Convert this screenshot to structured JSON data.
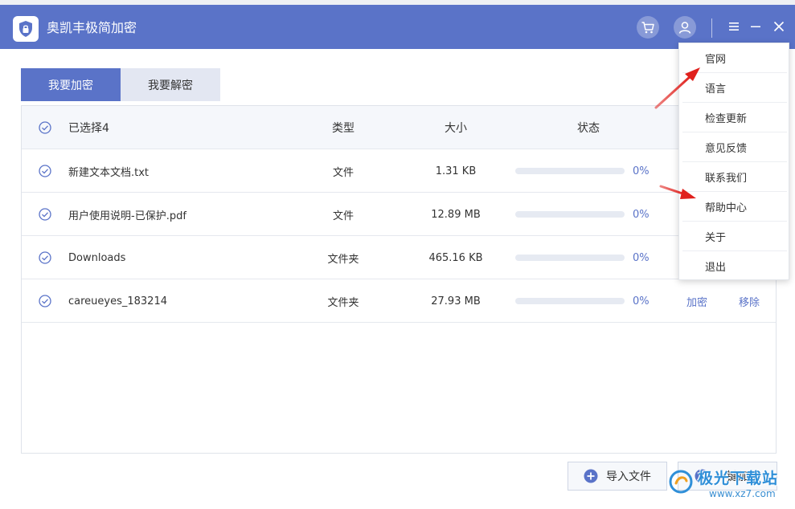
{
  "window": {
    "title": "奥凯丰极简加密"
  },
  "tabs": [
    {
      "label": "我要加密",
      "active": true
    },
    {
      "label": "我要解密",
      "active": false
    }
  ],
  "table": {
    "header": {
      "selected": "已选择4",
      "type": "类型",
      "size": "大小",
      "status": "状态"
    },
    "rows": [
      {
        "name": "新建文本文档.txt",
        "type": "文件",
        "size": "1.31 KB",
        "progress": 0,
        "progress_label": "0%",
        "action_encrypt": "",
        "action_remove": ""
      },
      {
        "name": "用户使用说明-已保护.pdf",
        "type": "文件",
        "size": "12.89 MB",
        "progress": 0,
        "progress_label": "0%",
        "action_encrypt": "",
        "action_remove": ""
      },
      {
        "name": "Downloads",
        "type": "文件夹",
        "size": "465.16 KB",
        "progress": 0,
        "progress_label": "0%",
        "action_encrypt": "",
        "action_remove": ""
      },
      {
        "name": "careueyes_183214",
        "type": "文件夹",
        "size": "27.93 MB",
        "progress": 0,
        "progress_label": "0%",
        "action_encrypt": "加密",
        "action_remove": "移除"
      }
    ]
  },
  "footer": {
    "import_label": "导入文件",
    "encrypt_all_label": "一键加密"
  },
  "dropdown_menu": {
    "items": [
      "官网",
      "语言",
      "检查更新",
      "意见反馈",
      "联系我们",
      "帮助中心",
      "关于",
      "退出"
    ]
  },
  "watermark": {
    "name": "极光下载站",
    "url": "www.xz7.com"
  },
  "colors": {
    "accent": "#5a73c8",
    "annotation_arrow": "#e0201c"
  }
}
